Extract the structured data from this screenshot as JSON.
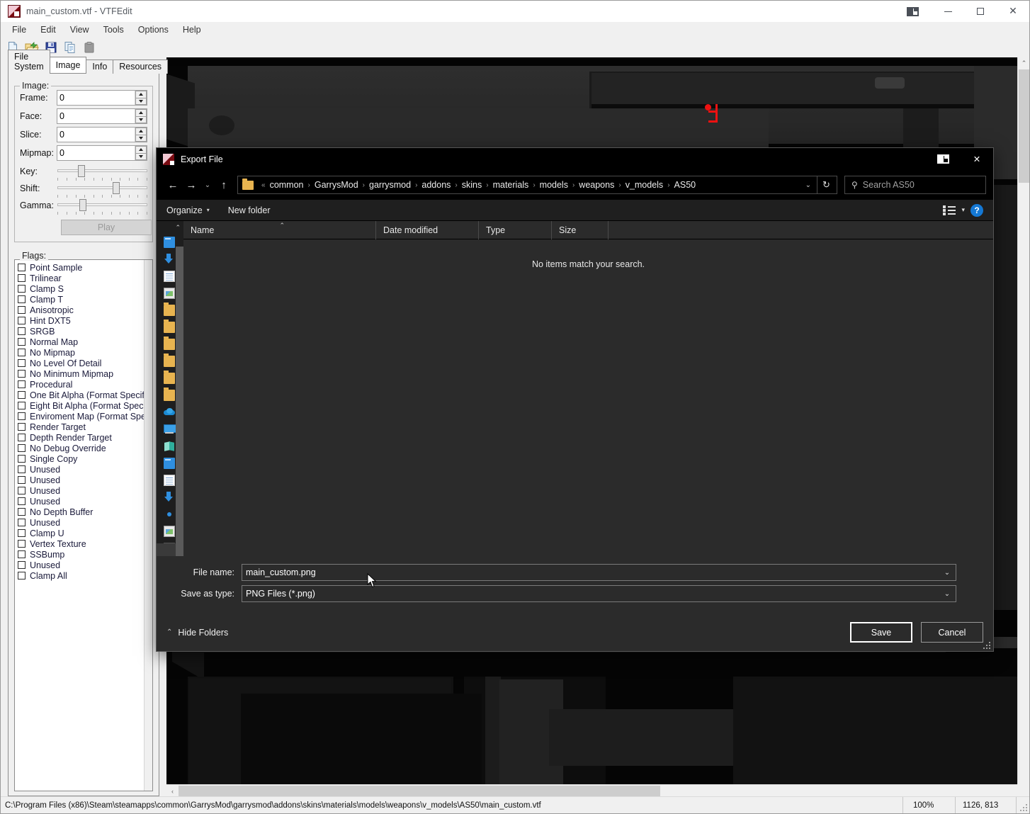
{
  "window": {
    "title": "main_custom.vtf - VTFEdit",
    "icon": "vtfedit-icon",
    "buttons": {
      "snap": "snap-layouts",
      "minimize": "—",
      "maximize": "□",
      "close": "✕"
    }
  },
  "menubar": {
    "items": [
      "File",
      "Edit",
      "View",
      "Tools",
      "Options",
      "Help"
    ]
  },
  "toolbar": {
    "items": [
      {
        "name": "new-file-icon",
        "label": "New"
      },
      {
        "name": "open-file-icon",
        "label": "Open"
      },
      {
        "name": "save-file-icon",
        "label": "Save"
      },
      {
        "name": "copy-icon",
        "label": "Copy"
      },
      {
        "name": "paste-icon",
        "label": "Paste"
      }
    ]
  },
  "tabs": [
    {
      "label": "File System",
      "active": false
    },
    {
      "label": "Image",
      "active": true
    },
    {
      "label": "Info",
      "active": false
    },
    {
      "label": "Resources",
      "active": false
    }
  ],
  "image_group": {
    "title": "Image:",
    "spinners": [
      {
        "label": "Frame:",
        "value": "0"
      },
      {
        "label": "Face:",
        "value": "0"
      },
      {
        "label": "Slice:",
        "value": "0"
      },
      {
        "label": "Mipmap:",
        "value": "0"
      }
    ],
    "sliders": [
      {
        "label": "Key:",
        "value": 24
      },
      {
        "label": "Shift:",
        "value": 66
      },
      {
        "label": "Gamma:",
        "value": 26
      }
    ],
    "play_button": "Play"
  },
  "flags_group": {
    "title": "Flags:",
    "items": [
      {
        "label": "Point Sample",
        "checked": false
      },
      {
        "label": "Trilinear",
        "checked": false
      },
      {
        "label": "Clamp S",
        "checked": false
      },
      {
        "label": "Clamp T",
        "checked": false
      },
      {
        "label": "Anisotropic",
        "checked": false
      },
      {
        "label": "Hint DXT5",
        "checked": false
      },
      {
        "label": "SRGB",
        "checked": false
      },
      {
        "label": "Normal Map",
        "checked": false
      },
      {
        "label": "No Mipmap",
        "checked": false
      },
      {
        "label": "No Level Of Detail",
        "checked": false
      },
      {
        "label": "No Minimum Mipmap",
        "checked": false
      },
      {
        "label": "Procedural",
        "checked": false
      },
      {
        "label": "One Bit Alpha (Format Specific)",
        "checked": false
      },
      {
        "label": "Eight Bit Alpha (Format Specific)",
        "checked": false
      },
      {
        "label": "Enviroment Map (Format Specific)",
        "checked": false
      },
      {
        "label": "Render Target",
        "checked": false
      },
      {
        "label": "Depth Render Target",
        "checked": false
      },
      {
        "label": "No Debug Override",
        "checked": false
      },
      {
        "label": "Single Copy",
        "checked": false
      },
      {
        "label": "Unused",
        "checked": false
      },
      {
        "label": "Unused",
        "checked": false
      },
      {
        "label": "Unused",
        "checked": false
      },
      {
        "label": "Unused",
        "checked": false
      },
      {
        "label": "No Depth Buffer",
        "checked": false
      },
      {
        "label": "Unused",
        "checked": false
      },
      {
        "label": "Clamp U",
        "checked": false
      },
      {
        "label": "Vertex Texture",
        "checked": false
      },
      {
        "label": "SSBump",
        "checked": false
      },
      {
        "label": "Unused",
        "checked": false
      },
      {
        "label": "Clamp All",
        "checked": false
      }
    ]
  },
  "statusbar": {
    "path": "C:\\Program Files (x86)\\Steam\\steamapps\\common\\GarrysMod\\garrysmod\\addons\\skins\\materials\\models\\weapons\\v_models\\AS50\\main_custom.vtf",
    "zoom": "100%",
    "coords": "1126, 813"
  },
  "dialog": {
    "title": "Export File",
    "icon": "vtfedit-icon",
    "titlebar_buttons": {
      "snap": "snap-layouts",
      "close": "✕"
    },
    "nav": {
      "back": "←",
      "forward": "→",
      "recent": "⌄",
      "up": "↑",
      "overflow": "«",
      "breadcrumbs": [
        "common",
        "GarrysMod",
        "garrysmod",
        "addons",
        "skins",
        "materials",
        "models",
        "weapons",
        "v_models",
        "AS50"
      ],
      "dropdown": "⌄",
      "refresh": "↻"
    },
    "search": {
      "placeholder": "Search AS50",
      "value": ""
    },
    "commandbar": {
      "organize": "Organize",
      "organize_caret": "▾",
      "new_folder": "New folder",
      "view_caret": "▾",
      "help": "?"
    },
    "navpane": {
      "scroll_up": "⌃",
      "scroll_down": "⌄",
      "items": [
        {
          "icon": "blue-folder-icon"
        },
        {
          "icon": "downloads-icon"
        },
        {
          "icon": "documents-icon"
        },
        {
          "icon": "pictures-icon"
        },
        {
          "icon": "folder-icon"
        },
        {
          "icon": "folder-icon"
        },
        {
          "icon": "folder-icon"
        },
        {
          "icon": "folder-icon"
        },
        {
          "icon": "folder-icon"
        },
        {
          "icon": "folder-icon"
        },
        {
          "icon": "onedrive-icon"
        },
        {
          "icon": "this-pc-icon"
        },
        {
          "icon": "teal-folder-icon"
        },
        {
          "icon": "blue-folder-icon"
        },
        {
          "icon": "documents-icon"
        },
        {
          "icon": "downloads-icon"
        },
        {
          "icon": "dot-icon"
        },
        {
          "icon": "pictures-icon"
        },
        {
          "icon": "music-icon"
        },
        {
          "icon": "network-icon"
        }
      ]
    },
    "filelist": {
      "columns": [
        {
          "label": "Name",
          "sort": "⌃"
        },
        {
          "label": "Date modified"
        },
        {
          "label": "Type"
        },
        {
          "label": "Size"
        }
      ],
      "empty_message": "No items match your search.",
      "rows": []
    },
    "fields": {
      "file_name_label": "File name:",
      "file_name_value": "main_custom.png",
      "save_as_type_label": "Save as type:",
      "save_as_type_value": "PNG Files (*.png)",
      "chevron": "⌄"
    },
    "footer": {
      "hide_folders": "Hide Folders",
      "hide_folders_chevron": "⌃",
      "save_button": "Save",
      "cancel_button": "Cancel"
    }
  },
  "preview": {
    "scroll_up": "⌃",
    "scroll_left": "‹",
    "description": "dark metallic weapon texture with red registration mark"
  },
  "colors": {
    "accent": "#1478d4",
    "dialog_bg": "#2b2b2b",
    "app_bg": "#f0f0f0",
    "texture_mark": "#ee1111"
  }
}
